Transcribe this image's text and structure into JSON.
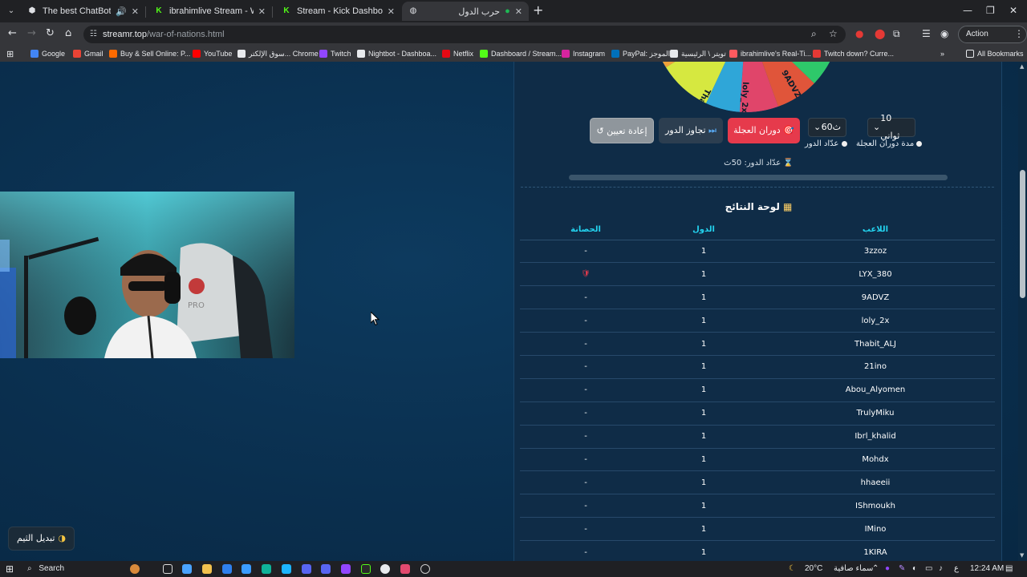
{
  "browser": {
    "tabs": [
      {
        "title": "The best ChatBot and Widg",
        "active": false,
        "icon": "robot-icon",
        "audio": true
      },
      {
        "title": "ibrahimlive Stream - Watch Live",
        "active": false,
        "icon": "kick-icon"
      },
      {
        "title": "Stream - Kick Dashboard",
        "active": false,
        "icon": "kick-icon"
      },
      {
        "title": "حرب الدول",
        "active": true,
        "icon": "globe-icon"
      }
    ],
    "url_host": "streamr.top",
    "url_path": "/war-of-nations.html",
    "action_required": "Action required",
    "bookmarks": [
      {
        "label": "Google",
        "icon": "google-icon",
        "color": "#4285f4"
      },
      {
        "label": "Gmail",
        "icon": "gmail-icon",
        "color": "#ea4335"
      },
      {
        "label": "Buy & Sell Online: P...",
        "icon": "shop-icon",
        "color": "#ff6a00"
      },
      {
        "label": "YouTube",
        "icon": "youtube-icon",
        "color": "#ff0000"
      },
      {
        "label": "سوق الإلكتر... Chrome",
        "icon": "store-icon",
        "color": "#e8eaed"
      },
      {
        "label": "Twitch",
        "icon": "twitch-icon",
        "color": "#9146ff"
      },
      {
        "label": "Nightbot - Dashboa...",
        "icon": "nightbot-icon",
        "color": "#e8eaed"
      },
      {
        "label": "Netflix",
        "icon": "netflix-icon",
        "color": "#e50914"
      },
      {
        "label": "Dashboard / Stream...",
        "icon": "stream-icon",
        "color": "#53fc18"
      },
      {
        "label": "Instagram",
        "icon": "instagram-icon",
        "color": "#d6249f"
      },
      {
        "label": "PayPal: الموجز",
        "icon": "paypal-icon",
        "color": "#0070ba"
      },
      {
        "label": "تويتر \\ الرئيسية",
        "icon": "x-icon",
        "color": "#e8eaed"
      },
      {
        "label": "ibrahimlive's Real-Ti...",
        "icon": "chart-icon",
        "color": "#ff5a5f"
      },
      {
        "label": "Twitch down? Curre...",
        "icon": "alert-icon",
        "color": "#e53935"
      }
    ],
    "all_bookmarks": "All Bookmarks"
  },
  "app": {
    "controls": {
      "reset_label": "إعادة تعيين",
      "reset_icon": "↺",
      "skip_label": "تجاوز الدور",
      "skip_icon": "⏭",
      "spin_label": "دوران العجلة",
      "spin_icon": "🎯",
      "turn_value": "60ث",
      "turn_label": "عدّاد الدور",
      "spin_value": "10 ثواني",
      "spin_duration_label": "مدة دوران العجلة"
    },
    "timer_text": "عدّاد الدور: 50ث",
    "timer_progress": 0.0,
    "wheel_labels": [
      "loly_2x",
      "9ADVZ",
      "Thabit_ALJ"
    ],
    "results": {
      "title": "لوحة النتائج",
      "columns": {
        "player": "اللاعب",
        "lives": "الدول",
        "shield": "الحصانة"
      },
      "rows": [
        {
          "player": "3zzoz",
          "lives": "1",
          "shield": "-"
        },
        {
          "player": "LYX_380",
          "lives": "1",
          "shield": "🛡"
        },
        {
          "player": "9ADVZ",
          "lives": "1",
          "shield": "-"
        },
        {
          "player": "loly_2x",
          "lives": "1",
          "shield": "-"
        },
        {
          "player": "Thabit_ALJ",
          "lives": "1",
          "shield": "-"
        },
        {
          "player": "21ino",
          "lives": "1",
          "shield": "-"
        },
        {
          "player": "Abou_Alyomen",
          "lives": "1",
          "shield": "-"
        },
        {
          "player": "TrulyMiku",
          "lives": "1",
          "shield": "-"
        },
        {
          "player": "Ibrl_khalid",
          "lives": "1",
          "shield": "-"
        },
        {
          "player": "Mohdx",
          "lives": "1",
          "shield": "-"
        },
        {
          "player": "hhaeeii",
          "lives": "1",
          "shield": "-"
        },
        {
          "player": "IShmoukh",
          "lives": "1",
          "shield": "-"
        },
        {
          "player": "IMino",
          "lives": "1",
          "shield": "-"
        },
        {
          "player": "1KIRA",
          "lives": "1",
          "shield": "-"
        }
      ]
    },
    "theme_button": "تبديل الثيم"
  },
  "taskbar": {
    "search": "Search",
    "weather_temp": "20°C",
    "weather_desc": "سماء صافية",
    "time": "12:24 AM",
    "lang": "ع"
  },
  "colors": {
    "accent_cyan": "#23d3ef",
    "spin_red": "#e63a4c"
  }
}
